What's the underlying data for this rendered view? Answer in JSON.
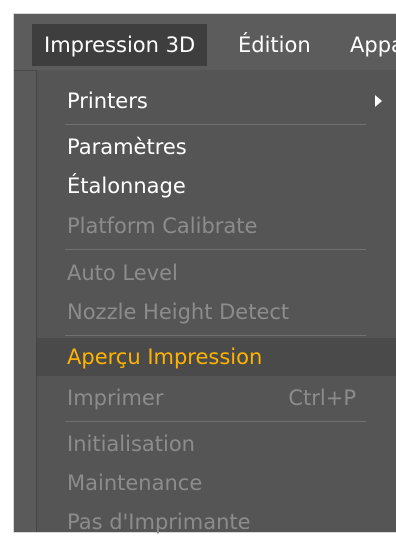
{
  "menubar": {
    "items": [
      {
        "label": "Impression 3D"
      },
      {
        "label": "Édition"
      },
      {
        "label": "Appa"
      }
    ]
  },
  "menu": {
    "printers": "Printers",
    "parametres": "Paramètres",
    "etalonnage": "Étalonnage",
    "platform_calibrate": "Platform Calibrate",
    "auto_level": "Auto Level",
    "nozzle_height_detect": "Nozzle Height Detect",
    "apercu_impression": "Aperçu Impression",
    "imprimer": "Imprimer",
    "imprimer_shortcut": "Ctrl+P",
    "initialisation": "Initialisation",
    "maintenance": "Maintenance",
    "pas_imprimante": "Pas d'Imprimante"
  },
  "colors": {
    "menu_bg": "#555555",
    "highlight_text": "#ffb300",
    "disabled_text": "#8c8c8c"
  }
}
